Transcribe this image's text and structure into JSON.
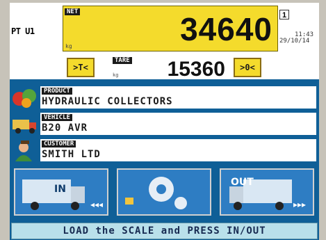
{
  "header": {
    "scale_label": "PT U1",
    "scale_number": "1",
    "time": "11:43",
    "date": "29/10/14"
  },
  "net": {
    "tag": "NET",
    "unit": "kg",
    "value": "34640"
  },
  "tare": {
    "tag": "TARE",
    "unit": "kg",
    "value": "15360"
  },
  "buttons": {
    "tare_key": ">T<",
    "zero_key": ">0<"
  },
  "fields": [
    {
      "tag": "PRODUCT",
      "value": "HYDRAULIC COLLECTORS",
      "icon": "leaf-product-icon"
    },
    {
      "tag": "VEHICLE",
      "value": "B20 AVR",
      "icon": "truck-icon"
    },
    {
      "tag": "CUSTOMER",
      "value": "SMITH LTD",
      "icon": "person-icon"
    }
  ],
  "actions": [
    {
      "label": "IN",
      "icon": "truck-in-icon"
    },
    {
      "label": "",
      "icon": "settings-lock-icon"
    },
    {
      "label": "OUT",
      "icon": "truck-out-icon"
    }
  ],
  "status": "LOAD the SCALE and PRESS IN/OUT",
  "colors": {
    "panel_yellow": "#f4db2c",
    "screen_blue": "#0f5f97",
    "status_bg": "#b9e0ea"
  }
}
